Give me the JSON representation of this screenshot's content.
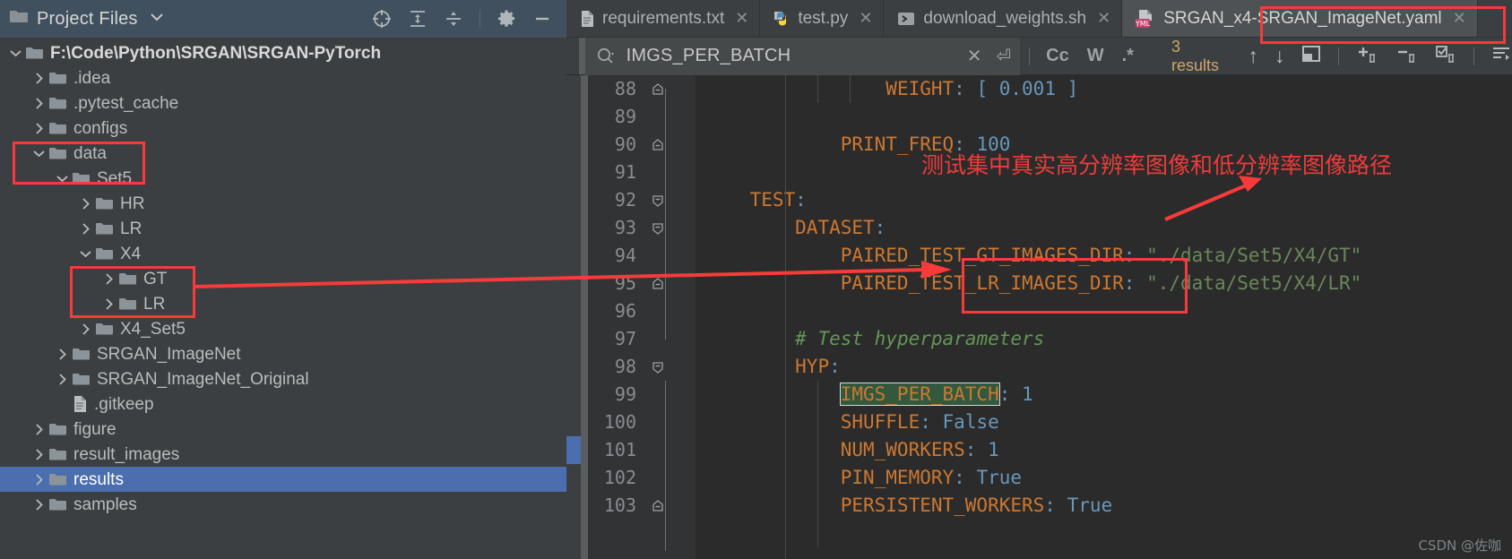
{
  "project_panel": {
    "header": {
      "title": "Project Files",
      "dropdown_caret": "▾",
      "icons": [
        {
          "name": "locate-target-icon",
          "glyph": "⊕"
        },
        {
          "name": "expand-all-icon",
          "glyph": "⇕"
        },
        {
          "name": "collapse-all-icon",
          "glyph": "⇵"
        },
        {
          "name": "settings-gear-icon",
          "glyph": "⚙"
        },
        {
          "name": "hide-panel-icon",
          "glyph": "—"
        }
      ]
    },
    "tree": [
      {
        "label": "F:\\Code\\Python\\SRGAN\\SRGAN-PyTorch",
        "depth": 0,
        "arrow": "down",
        "icon": "folder",
        "root": true,
        "selected": false
      },
      {
        "label": ".idea",
        "depth": 1,
        "arrow": "right",
        "icon": "folder",
        "root": false,
        "selected": false
      },
      {
        "label": ".pytest_cache",
        "depth": 1,
        "arrow": "right",
        "icon": "folder",
        "root": false,
        "selected": false
      },
      {
        "label": "configs",
        "depth": 1,
        "arrow": "right",
        "icon": "folder",
        "root": false,
        "selected": false
      },
      {
        "label": "data",
        "depth": 1,
        "arrow": "down",
        "icon": "folder",
        "root": false,
        "selected": false
      },
      {
        "label": "Set5",
        "depth": 2,
        "arrow": "down",
        "icon": "folder",
        "root": false,
        "selected": false
      },
      {
        "label": "HR",
        "depth": 3,
        "arrow": "right",
        "icon": "folder",
        "root": false,
        "selected": false
      },
      {
        "label": "LR",
        "depth": 3,
        "arrow": "right",
        "icon": "folder",
        "root": false,
        "selected": false
      },
      {
        "label": "X4",
        "depth": 3,
        "arrow": "down",
        "icon": "folder",
        "root": false,
        "selected": false
      },
      {
        "label": "GT",
        "depth": 4,
        "arrow": "right",
        "icon": "folder",
        "root": false,
        "selected": false
      },
      {
        "label": "LR",
        "depth": 4,
        "arrow": "right",
        "icon": "folder",
        "root": false,
        "selected": false
      },
      {
        "label": "X4_Set5",
        "depth": 3,
        "arrow": "right",
        "icon": "folder",
        "root": false,
        "selected": false
      },
      {
        "label": "SRGAN_ImageNet",
        "depth": 2,
        "arrow": "right",
        "icon": "folder",
        "root": false,
        "selected": false
      },
      {
        "label": "SRGAN_ImageNet_Original",
        "depth": 2,
        "arrow": "right",
        "icon": "folder",
        "root": false,
        "selected": false
      },
      {
        "label": ".gitkeep",
        "depth": 2,
        "arrow": "none",
        "icon": "file",
        "root": false,
        "selected": false
      },
      {
        "label": "figure",
        "depth": 1,
        "arrow": "right",
        "icon": "folder",
        "root": false,
        "selected": false
      },
      {
        "label": "result_images",
        "depth": 1,
        "arrow": "right",
        "icon": "folder",
        "root": false,
        "selected": false
      },
      {
        "label": "results",
        "depth": 1,
        "arrow": "right",
        "icon": "folder",
        "root": false,
        "selected": true
      },
      {
        "label": "samples",
        "depth": 1,
        "arrow": "right",
        "icon": "folder",
        "root": false,
        "selected": false
      }
    ]
  },
  "editor": {
    "tabs": [
      {
        "label": "requirements.txt",
        "icon": "text-file-icon",
        "active": false,
        "close": "✕"
      },
      {
        "label": "test.py",
        "icon": "python-file-icon",
        "active": false,
        "close": "✕"
      },
      {
        "label": "download_weights.sh",
        "icon": "shell-file-icon",
        "active": false,
        "close": "✕"
      },
      {
        "label": "SRGAN_x4-SRGAN_ImageNet.yaml",
        "icon": "yaml-file-icon",
        "active": true,
        "close": "✕"
      }
    ],
    "find": {
      "query": "IMGS_PER_BATCH",
      "search_icon": "search-icon",
      "clear_icon": "✕",
      "history_icon": "⏎",
      "match_case_label": "Cc",
      "words_label": "W",
      "regex_label": ".*",
      "results_label": "3 results",
      "prev_icon": "↑",
      "next_icon": "↓",
      "select_all_icon": "▣",
      "add_selection_icon": "＋",
      "remove_selection_icon": "－",
      "select_all_occurrences_icon": "☑",
      "filter_icon": "≡"
    },
    "code_lines": [
      {
        "num": "88",
        "fold": "end",
        "indent": 3,
        "tokens": [
          {
            "t": "WEIGHT",
            "c": "k"
          },
          {
            "t": ": ",
            "c": "pn"
          },
          {
            "t": "[ ",
            "c": "pn"
          },
          {
            "t": "0.001",
            "c": "pn"
          },
          {
            "t": " ]",
            "c": "pn"
          }
        ]
      },
      {
        "num": "89",
        "fold": "",
        "indent": 3,
        "tokens": []
      },
      {
        "num": "90",
        "fold": "end",
        "indent": 2,
        "tokens": [
          {
            "t": "PRINT_FREQ",
            "c": "k"
          },
          {
            "t": ": ",
            "c": "pn"
          },
          {
            "t": "100",
            "c": "pn"
          }
        ]
      },
      {
        "num": "91",
        "fold": "",
        "indent": 1,
        "tokens": []
      },
      {
        "num": "92",
        "fold": "start",
        "indent": 0,
        "tokens": [
          {
            "t": "TEST",
            "c": "k"
          },
          {
            "t": ":",
            "c": "pn"
          }
        ]
      },
      {
        "num": "93",
        "fold": "start",
        "indent": 1,
        "tokens": [
          {
            "t": "DATASET",
            "c": "k"
          },
          {
            "t": ":",
            "c": "pn"
          }
        ]
      },
      {
        "num": "94",
        "fold": "",
        "indent": 2,
        "tokens": [
          {
            "t": "PAIRED_TEST_GT_IMAGES_DIR",
            "c": "k"
          },
          {
            "t": ": ",
            "c": "pn"
          },
          {
            "t": "\"./data/Set5/X4/GT\"",
            "c": "st"
          }
        ]
      },
      {
        "num": "95",
        "fold": "end",
        "indent": 2,
        "tokens": [
          {
            "t": "PAIRED_TEST_LR_IMAGES_DIR",
            "c": "k"
          },
          {
            "t": ": ",
            "c": "pn"
          },
          {
            "t": "\"./data/Set5/X4/LR\"",
            "c": "st"
          }
        ]
      },
      {
        "num": "96",
        "fold": "",
        "indent": 1,
        "tokens": []
      },
      {
        "num": "97",
        "fold": "",
        "indent": 1,
        "tokens": [
          {
            "t": "# Test hyperparameters",
            "c": "cm"
          }
        ]
      },
      {
        "num": "98",
        "fold": "start",
        "indent": 1,
        "tokens": [
          {
            "t": "HYP",
            "c": "k"
          },
          {
            "t": ":",
            "c": "pn"
          }
        ]
      },
      {
        "num": "99",
        "fold": "",
        "indent": 2,
        "tokens": [
          {
            "t": "IMGS_PER_BATCH",
            "c": "k hl"
          },
          {
            "t": ": ",
            "c": "pn"
          },
          {
            "t": "1",
            "c": "pn"
          }
        ]
      },
      {
        "num": "100",
        "fold": "",
        "indent": 2,
        "tokens": [
          {
            "t": "SHUFFLE",
            "c": "k"
          },
          {
            "t": ": ",
            "c": "pn"
          },
          {
            "t": "False",
            "c": "pn"
          }
        ]
      },
      {
        "num": "101",
        "fold": "",
        "indent": 2,
        "tokens": [
          {
            "t": "NUM_WORKERS",
            "c": "k"
          },
          {
            "t": ": ",
            "c": "pn"
          },
          {
            "t": "1",
            "c": "pn"
          }
        ]
      },
      {
        "num": "102",
        "fold": "",
        "indent": 2,
        "tokens": [
          {
            "t": "PIN_MEMORY",
            "c": "k"
          },
          {
            "t": ": ",
            "c": "pn"
          },
          {
            "t": "True",
            "c": "pn"
          }
        ]
      },
      {
        "num": "103",
        "fold": "end",
        "indent": 2,
        "tokens": [
          {
            "t": "PERSISTENT_WORKERS",
            "c": "k"
          },
          {
            "t": ": ",
            "c": "pn"
          },
          {
            "t": "True",
            "c": "pn"
          }
        ]
      }
    ]
  },
  "annotations": {
    "note_text": "测试集中真实高分辨率图像和低分辨率图像路径",
    "note_color": "#ef3b3b",
    "box_color": "#f93a3a",
    "watermark": "CSDN @佐咖"
  },
  "colors": {
    "panel_bg": "#3c3f41",
    "header_bg": "#41505e",
    "editor_bg": "#2b2b2b",
    "gutter_bg": "#313335",
    "selection_blue": "#4b6eaf",
    "key_orange": "#cc7832",
    "string_green": "#6a8759",
    "number_blue": "#6897bb",
    "highlight_green": "#32593d"
  }
}
